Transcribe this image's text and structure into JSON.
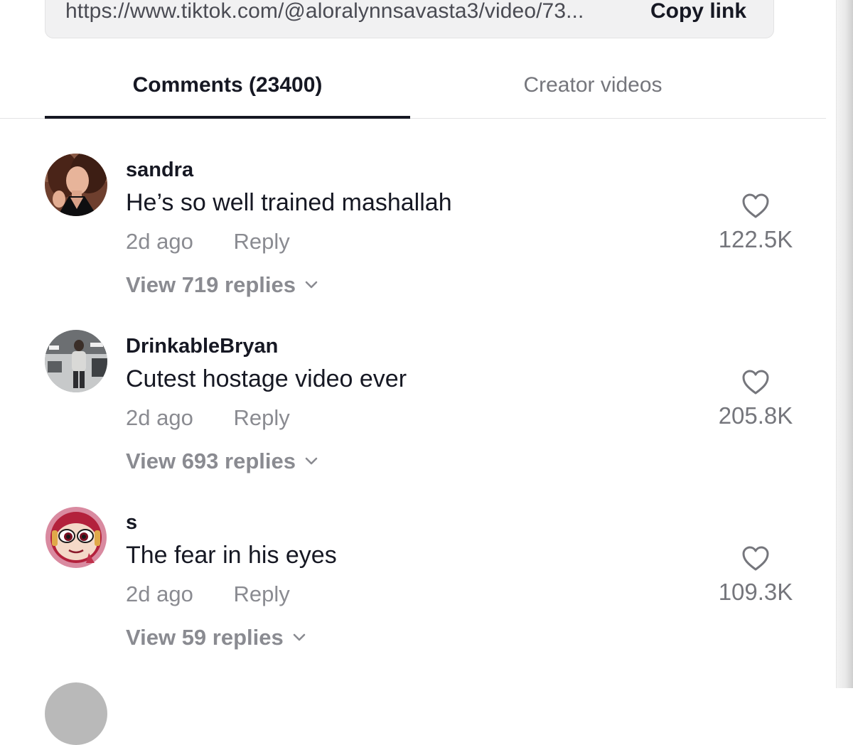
{
  "link_bar": {
    "url": "https://www.tiktok.com/@aloralynnsavasta3/video/73...",
    "copy_label": "Copy link"
  },
  "tabs": [
    {
      "label": "Comments (23400)",
      "active": true
    },
    {
      "label": "Creator videos",
      "active": false
    }
  ],
  "comments": [
    {
      "username": "sandra",
      "text": "He’s so well trained mashallah",
      "time": "2d ago",
      "reply_label": "Reply",
      "replies_label": "View 719 replies",
      "likes": "122.5K",
      "avatar": "woman-photo-avatar"
    },
    {
      "username": "DrinkableBryan",
      "text": "Cutest hostage video ever",
      "time": "2d ago",
      "reply_label": "Reply",
      "replies_label": "View 693 replies",
      "likes": "205.8K",
      "avatar": "man-in-garage-photo-avatar"
    },
    {
      "username": "s",
      "text": "The fear in his eyes",
      "time": "2d ago",
      "reply_label": "Reply",
      "replies_label": "View 59 replies",
      "likes": "109.3K",
      "avatar": "cartoon-girl-avatar"
    }
  ],
  "icons": {
    "like": "heart-outline-icon",
    "expand": "chevron-down-icon"
  },
  "colors": {
    "primary_text": "#161823",
    "secondary_text": "#8a8b91",
    "tab_inactive": "#75767c",
    "link_bar_bg": "#f1f1f2",
    "divider": "#e3e3e4"
  }
}
